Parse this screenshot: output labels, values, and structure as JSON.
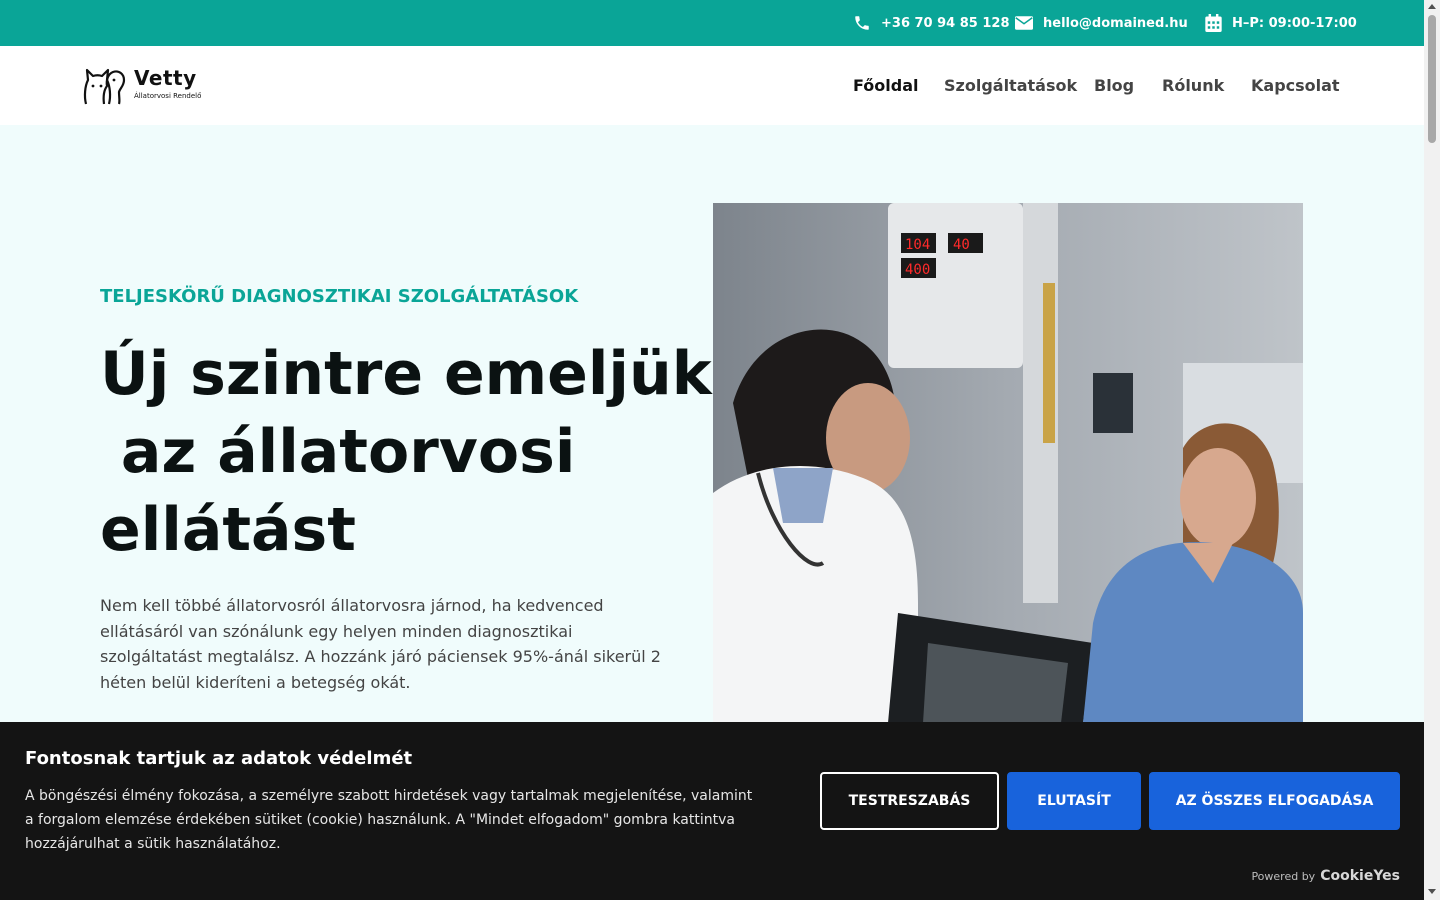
{
  "topbar": {
    "phone": "+36 70 94 85 128",
    "email": "hello@domained.hu",
    "hours": "H–P: 09:00-17:00"
  },
  "brand": {
    "name": "Vetty",
    "tagline": "Állatorvosi Rendelő"
  },
  "nav": {
    "items": [
      {
        "label": "Főoldal",
        "active": true
      },
      {
        "label": "Szolgáltatások",
        "active": false
      },
      {
        "label": "Blog",
        "active": false
      },
      {
        "label": "Rólunk",
        "active": false
      },
      {
        "label": "Kapcsolat",
        "active": false
      }
    ]
  },
  "hero": {
    "eyebrow": "TELJESKÖRŰ DIAGNOSZTIKAI SZOLGÁLTATÁSOK",
    "title_lines": [
      "Új szintre emeljük",
      " az állatorvosi",
      "ellátást"
    ],
    "text": "Nem kell többé állatorvosról állatorvosra járnod, ha kedvenced ellátásáról van szónálunk egy helyen minden diagnosztikai szolgáltatást megtalálsz. A hozzánk járó páciensek 95%-ánál sikerül 2 héten belül kideríteni a betegség okát."
  },
  "cookie": {
    "title": "Fontosnak tartjuk az adatok védelmét",
    "text": "A böngészési élmény fokozása, a személyre szabott hirdetések vagy tartalmak megjelenítése, valamint a forgalom elemzése érdekében sütiket (cookie) használunk. A \"Mindet elfogadom\" gombra kattintva hozzájárulhat a sütik használatához.",
    "customize_label": "TESTRESZABÁS",
    "reject_label": "ELUTASÍT",
    "accept_label": "AZ ÖSSZES ELFOGADÁSA",
    "powered_by": "Powered by",
    "powered_brand": "CookieYes"
  },
  "colors": {
    "accent": "#0aa597",
    "hero_bg": "#f0fcfc",
    "button_blue": "#1863dc",
    "banner_bg": "#141414"
  }
}
